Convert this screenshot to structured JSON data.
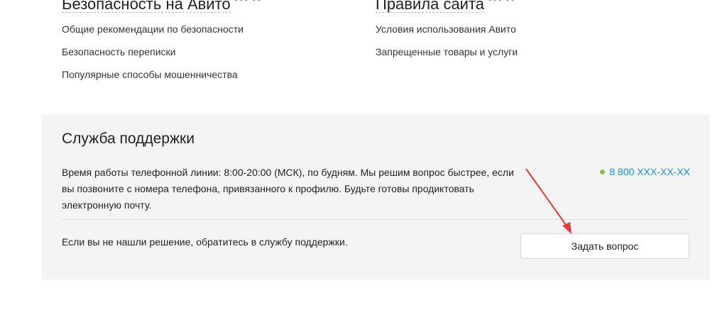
{
  "safety": {
    "title": "Безопасность на Авито",
    "links": [
      "Общие рекомендации по безопасности",
      "Безопасность переписки",
      "Популярные способы мошенничества"
    ]
  },
  "rules": {
    "title": "Правила сайта",
    "links": [
      "Условия использования Авито",
      "Запрещенные товары и услуги"
    ]
  },
  "support": {
    "title": "Служба поддержки",
    "hours_text": "Время работы телефонной линии: 8:00-20:00 (МСК), по будням. Мы решим вопрос быстрее, если вы позвоните с номера телефона, привязанного к профилю. Будьте готовы продиктовать электронную почту.",
    "phone": "8 800 XXX-XX-XX",
    "not_found_text": "Если вы не нашли решение, обратитесь в службу поддержки.",
    "ask_button": "Задать вопрос"
  },
  "colors": {
    "link_blue": "#1a8dd8",
    "status_green": "#8bc34a",
    "annotation_red": "#e53935",
    "panel_bg": "#f4f4f4"
  }
}
